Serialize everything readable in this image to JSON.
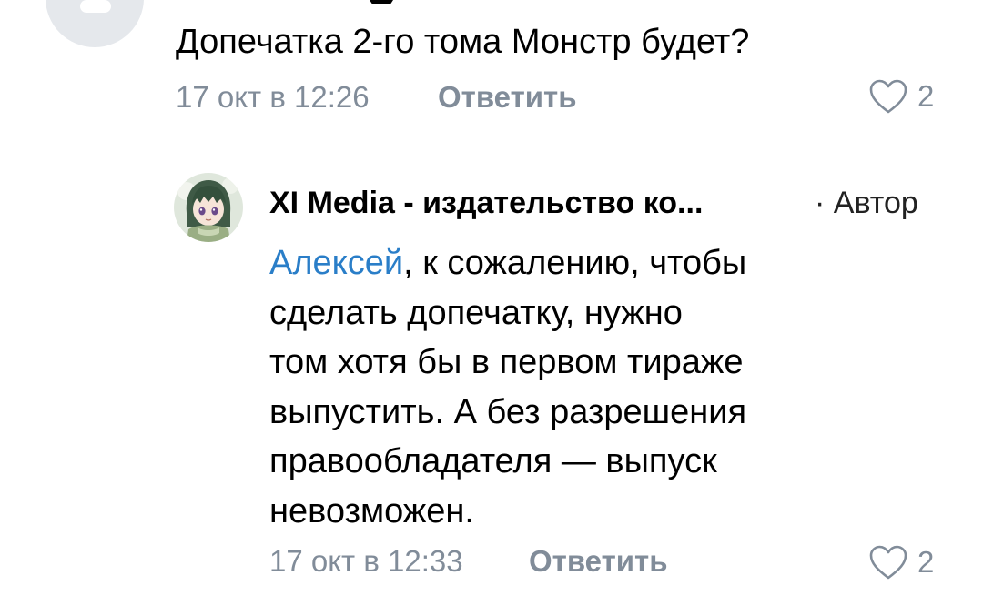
{
  "comment_1": {
    "text": "Допечатка 2-го тома Монстр будет?",
    "date": "17 окт в 12:26",
    "reply_label": "Ответить",
    "likes": "2"
  },
  "comment_2": {
    "author_name": "XI Media - издательство ко...",
    "author_badge": "· Автор",
    "mention": "Алексей",
    "lines": [
      ", к сожалению, чтобы",
      "сделать допечатку, нужно",
      "том хотя бы в первом тираже",
      "выпустить. А без разрешения",
      "правообладателя — выпуск",
      "невозможен."
    ],
    "date": "17 окт в 12:33",
    "reply_label": "Ответить",
    "likes": "2"
  },
  "colors": {
    "meta_gray": "#818c99",
    "mention_blue": "#2a7ec8",
    "avatar_placeholder": "#e5e8ec"
  },
  "icons": {
    "like": "heart-outline-icon",
    "avatar_placeholder": "user-placeholder-icon"
  }
}
